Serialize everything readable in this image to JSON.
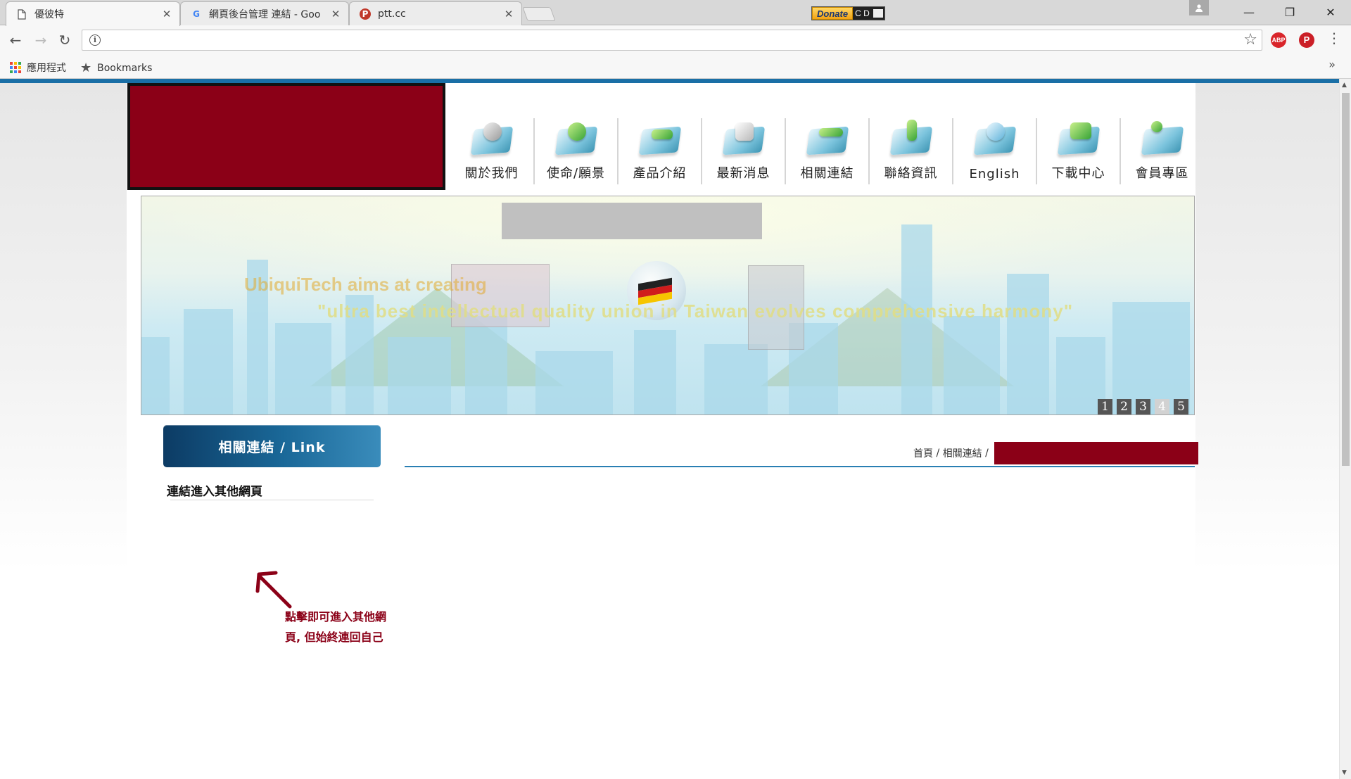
{
  "browser": {
    "tabs": [
      {
        "title": "優彼特",
        "icon": "page-icon",
        "active": true
      },
      {
        "title": "網頁後台管理 連結 - Goo",
        "icon": "google-icon",
        "active": false
      },
      {
        "title": "ptt.cc",
        "icon": "ptt-icon",
        "active": false
      }
    ],
    "donate": {
      "label": "Donate",
      "letters": "C D"
    },
    "window_buttons": {
      "minimize": "—",
      "restore": "❐",
      "close": "✕"
    },
    "address": "",
    "bookmarks": {
      "apps": "應用程式",
      "bookmarks": "Bookmarks"
    },
    "extensions": {
      "abp": "ABP",
      "pinterest": "P"
    }
  },
  "site": {
    "nav": [
      {
        "label": "關於我們",
        "icon": "about-icon"
      },
      {
        "label": "使命/願景",
        "icon": "mission-icon"
      },
      {
        "label": "產品介紹",
        "icon": "products-icon"
      },
      {
        "label": "最新消息",
        "icon": "news-icon"
      },
      {
        "label": "相關連結",
        "icon": "links-icon"
      },
      {
        "label": "聯絡資訊",
        "icon": "contact-icon"
      },
      {
        "label": "English",
        "icon": "english-icon"
      },
      {
        "label": "下載中心",
        "icon": "download-icon"
      },
      {
        "label": "會員專區",
        "icon": "member-icon"
      }
    ],
    "banner": {
      "line1": "UbiquiTech aims at creating",
      "line2": "\"ultra best intellectual quality union in Taiwan evolves comprehensive harmony\"",
      "pages": [
        "1",
        "2",
        "3",
        "4",
        "5"
      ],
      "active_page": 4
    },
    "sidebar": {
      "header": "相關連結  /  Link",
      "link": "連結進入其他網頁"
    },
    "breadcrumb": {
      "home": "首頁",
      "sep1": " / ",
      "section": "相關連結",
      "sep2": " / "
    },
    "annotation": "點擊即可進入其他網頁, 但始終連回自己"
  },
  "colors": {
    "accent": "#1a6fa6",
    "redaction": "#8b0017",
    "annotation": "#8b0017"
  }
}
